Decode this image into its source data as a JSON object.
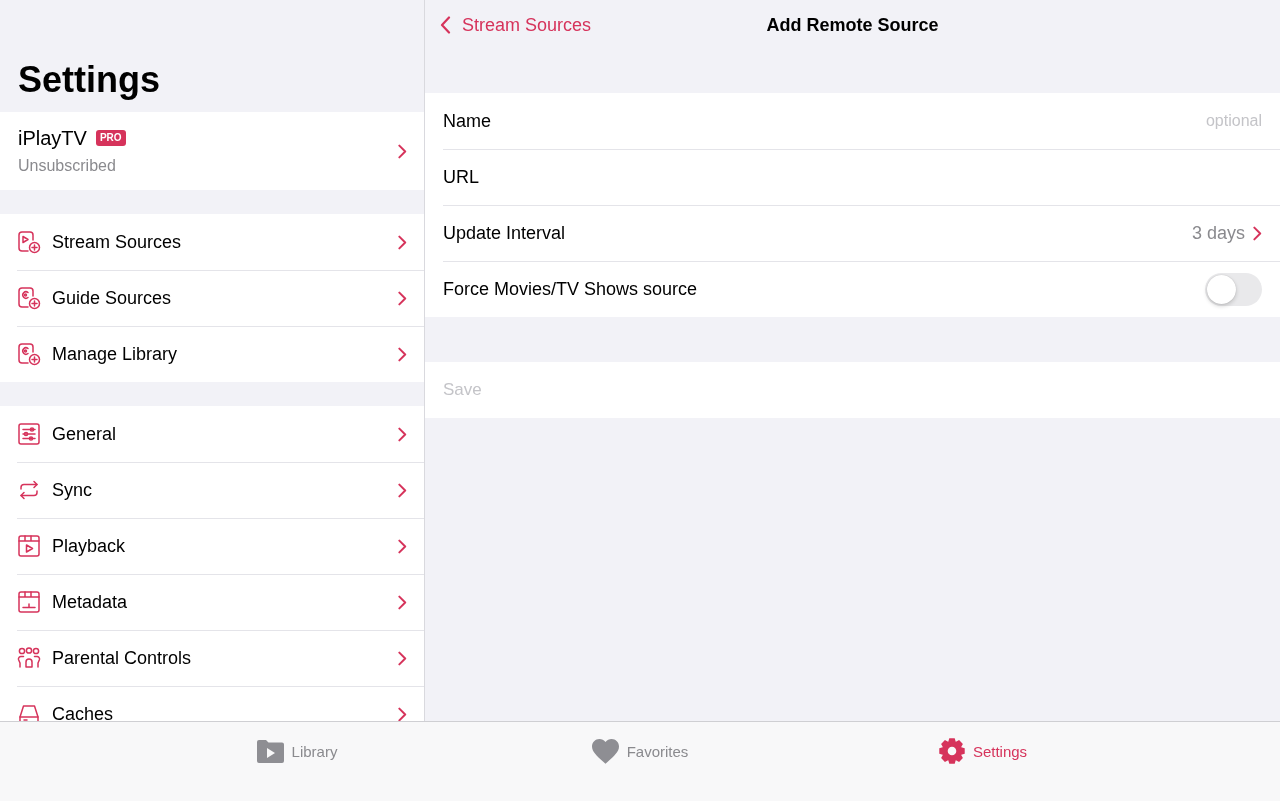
{
  "sidebar": {
    "title": "Settings",
    "account": {
      "name": "iPlayTV",
      "badge": "PRO",
      "status": "Unsubscribed"
    },
    "groups": [
      {
        "items": [
          {
            "label": "Stream Sources",
            "kind": "stream"
          },
          {
            "label": "Guide Sources",
            "kind": "guide"
          },
          {
            "label": "Manage Library",
            "kind": "library"
          }
        ]
      },
      {
        "items": [
          {
            "label": "General",
            "kind": "general"
          },
          {
            "label": "Sync",
            "kind": "sync"
          },
          {
            "label": "Playback",
            "kind": "playback"
          },
          {
            "label": "Metadata",
            "kind": "metadata"
          },
          {
            "label": "Parental Controls",
            "kind": "parental"
          },
          {
            "label": "Caches",
            "kind": "caches"
          }
        ]
      }
    ]
  },
  "detail": {
    "back": "Stream Sources",
    "title": "Add Remote Source",
    "fields": [
      {
        "kind": "text",
        "label": "Name",
        "placeholder": "optional"
      },
      {
        "kind": "text",
        "label": "URL"
      },
      {
        "kind": "picker",
        "label": "Update Interval",
        "value": "3 days"
      },
      {
        "kind": "toggle",
        "label": "Force Movies/TV Shows source",
        "on": false
      }
    ],
    "save": {
      "label": "Save",
      "disabled": true
    }
  },
  "tab_bar": {
    "tabs": [
      {
        "label": "Library",
        "kind": "library",
        "selected": false
      },
      {
        "label": "Favorites",
        "kind": "favorites",
        "selected": false
      },
      {
        "label": "Settings",
        "kind": "settings",
        "selected": true
      }
    ]
  }
}
